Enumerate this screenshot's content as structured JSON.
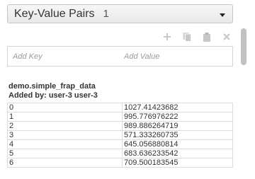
{
  "header": {
    "title": "Key-Value Pairs",
    "count": "1"
  },
  "toolbar": {
    "icons": [
      "plus-icon",
      "copy-icon",
      "paste-icon",
      "close-icon"
    ]
  },
  "inputs": {
    "key_placeholder": "Add Key",
    "value_placeholder": "Add Value"
  },
  "section": {
    "name": "demo.simple_frap_data",
    "added_by": "Added by: user-3 user-3",
    "rows": [
      {
        "key": "0",
        "value": "1027.41423682"
      },
      {
        "key": "1",
        "value": "995.776976222"
      },
      {
        "key": "2",
        "value": "989.886264719"
      },
      {
        "key": "3",
        "value": "571.333260735"
      },
      {
        "key": "4",
        "value": "645.056880814"
      },
      {
        "key": "5",
        "value": "683.636233542"
      },
      {
        "key": "6",
        "value": "709.500183545"
      }
    ]
  },
  "colors": {
    "icon_disabled": "#c8c8c8",
    "border": "#dcdcdc"
  }
}
